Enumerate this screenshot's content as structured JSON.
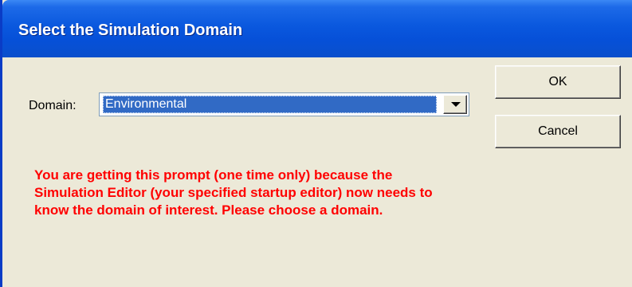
{
  "window": {
    "title": "Select the Simulation Domain"
  },
  "domain": {
    "label": "Domain:",
    "selected_value": "Environmental"
  },
  "buttons": {
    "ok_label": "OK",
    "cancel_label": "Cancel"
  },
  "message": {
    "lines": [
      "You are getting this prompt (one time only) because the",
      "Simulation Editor (your specified startup editor) now needs to",
      "know the domain of interest.  Please choose a domain."
    ]
  },
  "colors": {
    "titlebar": "#0a58de",
    "dialog_background": "#ece9d8",
    "selection_highlight": "#316ac5",
    "message_text": "#ff0000"
  },
  "icons": {
    "dropdown": "chevron-down-icon"
  }
}
